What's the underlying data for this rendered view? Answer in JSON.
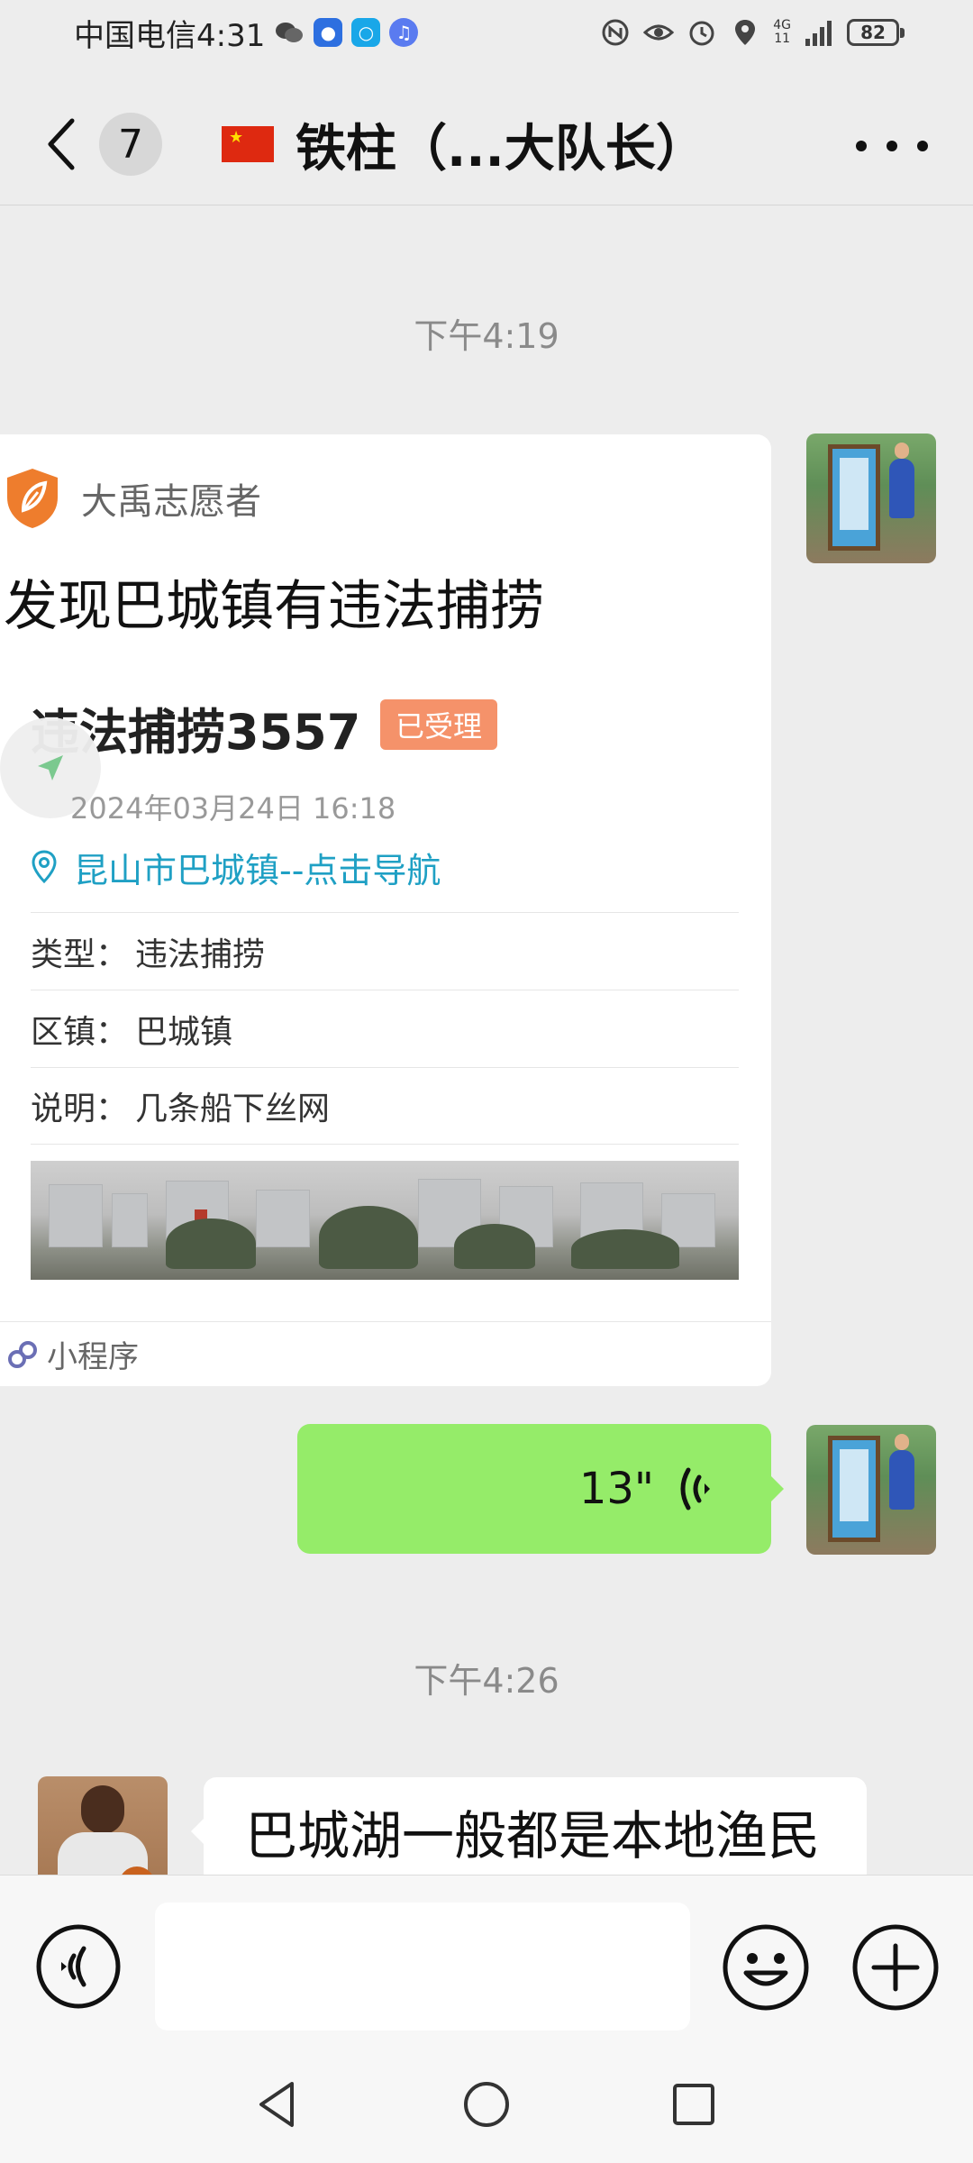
{
  "status_bar": {
    "carrier_time": "中国电信4:31",
    "network_top": "4G",
    "network_bottom": "11",
    "battery": "82"
  },
  "nav": {
    "unread_count": "7",
    "title": "铁柱（...大队长）"
  },
  "messages": {
    "timestamp_1": "下午4:19",
    "timestamp_2": "下午4:26",
    "mini_program": {
      "source_name": "大禹志愿者",
      "title": "发现巴城镇有违法捕捞",
      "report_name": "违法捕捞3557",
      "status": "已受理",
      "time": "2024年03月24日 16:18",
      "location": "昆山市巴城镇--点击导航",
      "fields": [
        {
          "label": "类型：",
          "value": "违法捕捞"
        },
        {
          "label": "区镇：",
          "value": "巴城镇"
        },
        {
          "label": "说明：",
          "value": "几条船下丝网"
        }
      ],
      "footer_label": "小程序"
    },
    "voice": {
      "duration": "13\""
    },
    "incoming_text": "巴城湖一般都是本地渔民"
  },
  "colors": {
    "bubble_green": "#95ec69",
    "status_orange": "#f5926a",
    "link_teal": "#1fa0c4",
    "logo_orange": "#ee7d2d"
  },
  "icons": {
    "back": "chevron-left-icon",
    "more": "ellipsis-icon",
    "voice_wave": "voice-wave-icon",
    "location_pin": "location-pin-icon",
    "navigate": "navigation-arrow-icon",
    "mini_program": "mini-program-link-icon",
    "voice_input": "voice-input-icon",
    "emoji": "emoji-icon",
    "plus": "plus-icon"
  }
}
